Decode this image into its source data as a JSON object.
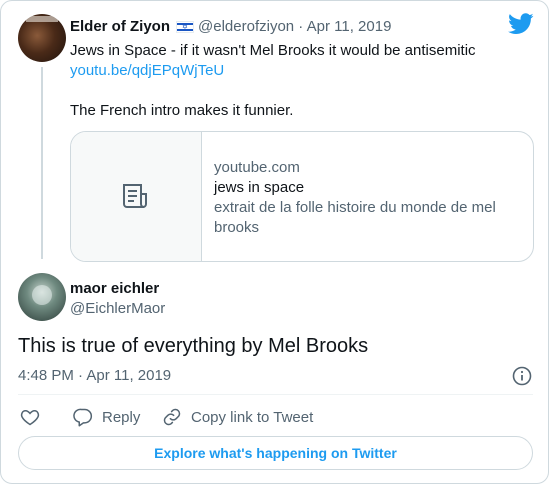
{
  "quoted_tweet": {
    "author_name": "Elder of Ziyon",
    "handle": "@elderofziyon",
    "date": "Apr 11, 2019",
    "text_line1": "Jews in Space - if it wasn't Mel Brooks it would be antisemitic",
    "link_text": "youtu.be/qdjEPqWjTeU",
    "text_line2": "The French intro makes it funnier.",
    "link_card": {
      "domain": "youtube.com",
      "title": "jews in space",
      "description": "extrait de la folle histoire du monde de mel brooks"
    }
  },
  "tweet": {
    "author_name": "maor eichler",
    "handle": "@EichlerMaor",
    "text": "This is true of everything by Mel Brooks",
    "timestamp": "4:48 PM · Apr 11, 2019"
  },
  "actions": {
    "reply_label": "Reply",
    "copy_label": "Copy link to Tweet"
  },
  "footer": {
    "explore_label": "Explore what's happening on Twitter"
  },
  "colors": {
    "accent": "#1d9bf0",
    "text_primary": "#0f1419",
    "text_secondary": "#536471",
    "border": "#cfd9de"
  },
  "icons": [
    "twitter-bird-icon",
    "israel-flag-icon",
    "document-icon",
    "info-icon",
    "heart-icon",
    "reply-icon",
    "copy-link-icon"
  ]
}
